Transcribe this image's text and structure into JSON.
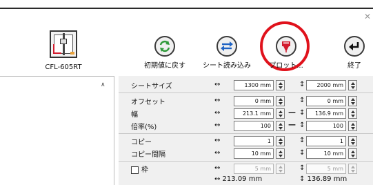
{
  "device": {
    "model": "CFL-605RT"
  },
  "toolbar": {
    "reset_label": "初期値に戻す",
    "load_sheet_label": "シート読み込み",
    "plot_label": "プロット...",
    "exit_label": "終了"
  },
  "settings": {
    "sheet_size": {
      "label": "シートサイズ",
      "width": "1300 mm",
      "height": "2000 mm"
    },
    "offset": {
      "label": "オフセット",
      "width": "0 mm",
      "height": "0 mm"
    },
    "size": {
      "label": "幅",
      "width": "213.1 mm",
      "height": "136.9 mm"
    },
    "scale": {
      "label": "倍率(%)",
      "width": "100",
      "height": "100"
    },
    "copy": {
      "label": "コピー",
      "width": "1",
      "height": "1"
    },
    "copy_spacing": {
      "label": "コピー間隔",
      "width": "10 mm",
      "height": "10 mm"
    },
    "frame": {
      "label": "枠",
      "width": "5 mm",
      "height": "5 mm",
      "checked": false
    }
  },
  "summary": {
    "width": "↔ 213.09 mm",
    "height": "↕ 136.89 mm"
  },
  "symbols": {
    "horizontal": "↔",
    "vertical": "↕",
    "link": "—"
  },
  "colors": {
    "accent": "#e0121c",
    "reset_icon": "#2f9a3a",
    "load_icon": "#1f63c4",
    "plot_icon": "#d21b2d"
  }
}
